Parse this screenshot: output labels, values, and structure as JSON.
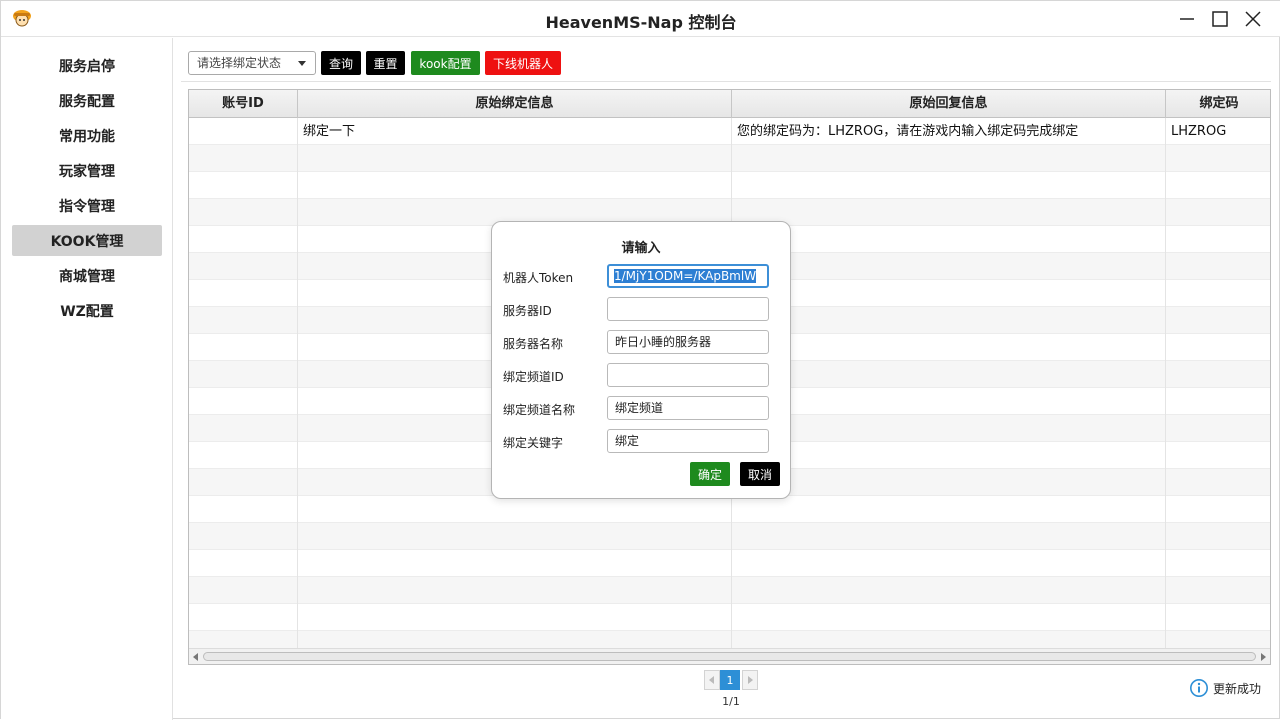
{
  "window": {
    "title": "HeavenMS-Nap 控制台"
  },
  "sidebar": {
    "items": [
      {
        "label": "服务启停"
      },
      {
        "label": "服务配置"
      },
      {
        "label": "常用功能"
      },
      {
        "label": "玩家管理"
      },
      {
        "label": "指令管理"
      },
      {
        "label": "KOOK管理",
        "active": true
      },
      {
        "label": "商城管理"
      },
      {
        "label": "WZ配置"
      }
    ]
  },
  "toolbar": {
    "filter_placeholder": "请选择绑定状态",
    "query_label": "查询",
    "reset_label": "重置",
    "kook_config_label": "kook配置",
    "offline_bot_label": "下线机器人"
  },
  "table": {
    "columns": [
      "账号ID",
      "原始绑定信息",
      "原始回复信息",
      "绑定码"
    ],
    "rows": [
      {
        "account_id": "",
        "bind_info": "绑定一下",
        "reply_info": "您的绑定码为：LHZROG，请在游戏内输入绑定码完成绑定",
        "bind_code": "LHZROG"
      }
    ]
  },
  "dialog": {
    "title": "请输入",
    "fields": [
      {
        "label": "机器人Token",
        "value": "1/MjY1ODM=/KApBmlW"
      },
      {
        "label": "服务器ID",
        "value": ""
      },
      {
        "label": "服务器名称",
        "value": "昨日小睡的服务器"
      },
      {
        "label": "绑定频道ID",
        "value": ""
      },
      {
        "label": "绑定频道名称",
        "value": "绑定频道"
      },
      {
        "label": "绑定关键字",
        "value": "绑定"
      }
    ],
    "ok_label": "确定",
    "cancel_label": "取消"
  },
  "pagination": {
    "current_page": "1",
    "info": "1/1"
  },
  "status": {
    "icon": "info-icon",
    "text": "更新成功"
  },
  "colors": {
    "accent": "#2d8fd6",
    "green": "#1e8a1e",
    "red": "#ee1111",
    "black": "#000000",
    "active_nav": "#d2d2d2"
  }
}
